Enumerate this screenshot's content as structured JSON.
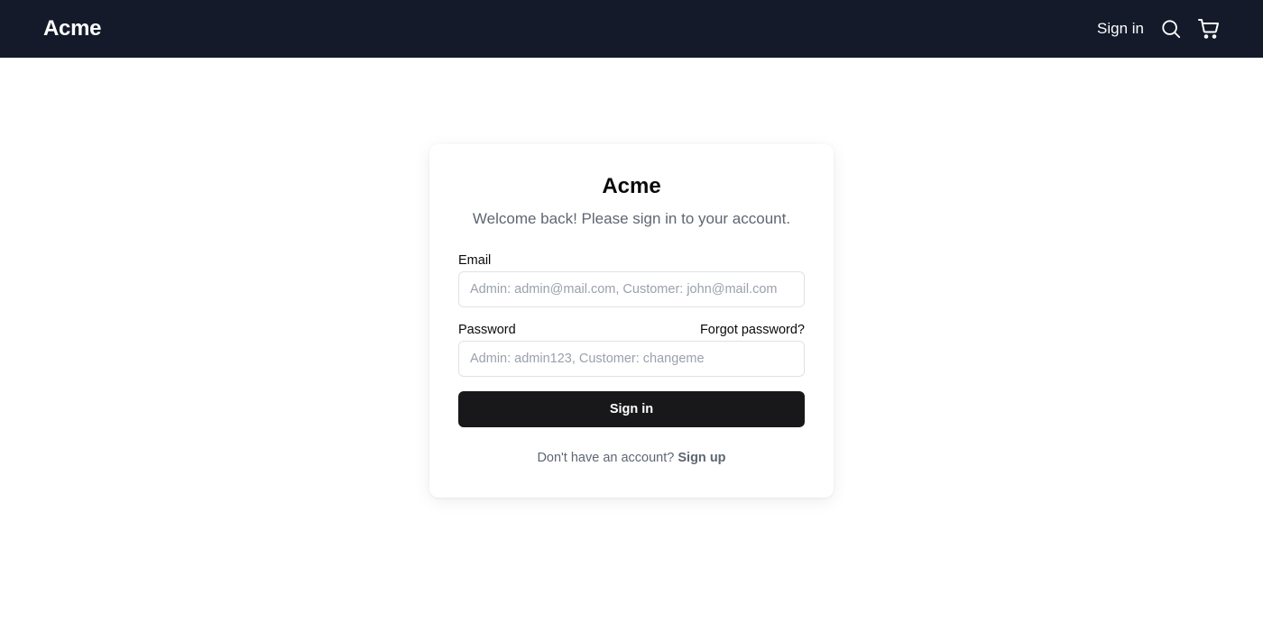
{
  "header": {
    "logo": "Acme",
    "signin_label": "Sign in",
    "icons": [
      "search-icon",
      "cart-icon"
    ],
    "background_color": "#141a2a"
  },
  "login_card": {
    "title": "Acme",
    "subtitle": "Welcome back! Please sign in to your account.",
    "email": {
      "label": "Email",
      "value": "",
      "placeholder": "Admin: admin@mail.com, Customer: john@mail.com"
    },
    "password": {
      "label": "Password",
      "forgot_label": "Forgot password?",
      "value": "",
      "placeholder": "Admin: admin123, Customer: changeme"
    },
    "submit_label": "Sign in",
    "signup_prompt": "Don't have an account?",
    "signup_label": "Sign up",
    "button_color": "#18181b"
  }
}
